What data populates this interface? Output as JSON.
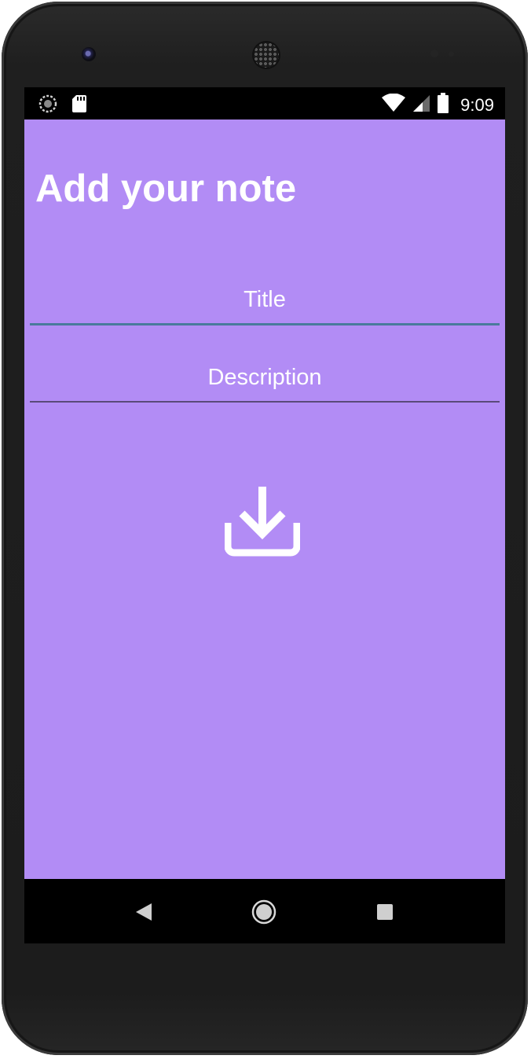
{
  "status_bar": {
    "time": "9:09",
    "icons": [
      "sync-icon",
      "sd-card-icon",
      "wifi-icon",
      "signal-icon",
      "battery-icon"
    ]
  },
  "screen": {
    "title": "Add your note",
    "title_field": {
      "placeholder": "Title",
      "value": ""
    },
    "description_field": {
      "placeholder": "Description",
      "value": ""
    },
    "save_button_icon": "download-icon"
  },
  "nav_bar": {
    "icons": [
      "back-icon",
      "home-icon",
      "recents-icon"
    ]
  },
  "colors": {
    "background": "#b28cf5",
    "text": "#ffffff",
    "title_underline": "#4a7a9c",
    "description_underline": "#5a4a7a"
  }
}
